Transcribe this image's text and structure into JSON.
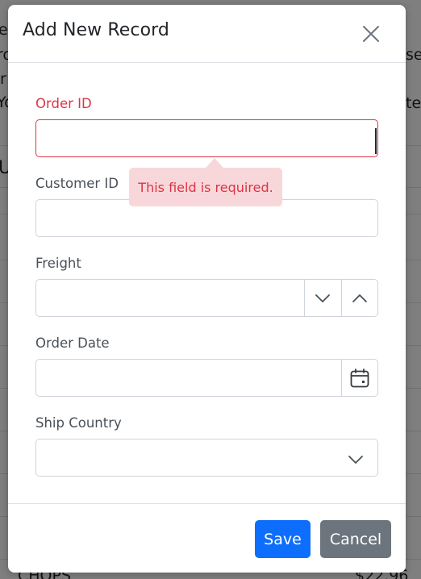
{
  "background_fragments": {
    "left_1": "e",
    "left_2": "ro",
    "left_3": "r",
    "left_4": "Yo",
    "left_5": "U",
    "right_1": "sel",
    "right_2": "te",
    "bottom_left": "CHOPS",
    "bottom_right": "$22.96"
  },
  "dialog": {
    "title": "Add New Record",
    "close_label": "Close"
  },
  "form": {
    "order_id": {
      "label": "Order ID",
      "value": "",
      "error": "This field is required."
    },
    "customer_id": {
      "label": "Customer ID",
      "value": ""
    },
    "freight": {
      "label": "Freight",
      "value": "",
      "decrement_icon": "chevron-down-icon",
      "increment_icon": "chevron-up-icon"
    },
    "order_date": {
      "label": "Order Date",
      "value": "",
      "picker_icon": "calendar-icon"
    },
    "ship_country": {
      "label": "Ship Country",
      "value": "",
      "dropdown_icon": "chevron-down-icon"
    }
  },
  "footer": {
    "save_label": "Save",
    "cancel_label": "Cancel"
  },
  "colors": {
    "primary": "#0d6efd",
    "secondary": "#6c757d",
    "error": "#dc3545",
    "error_bg": "#f8d7da"
  }
}
